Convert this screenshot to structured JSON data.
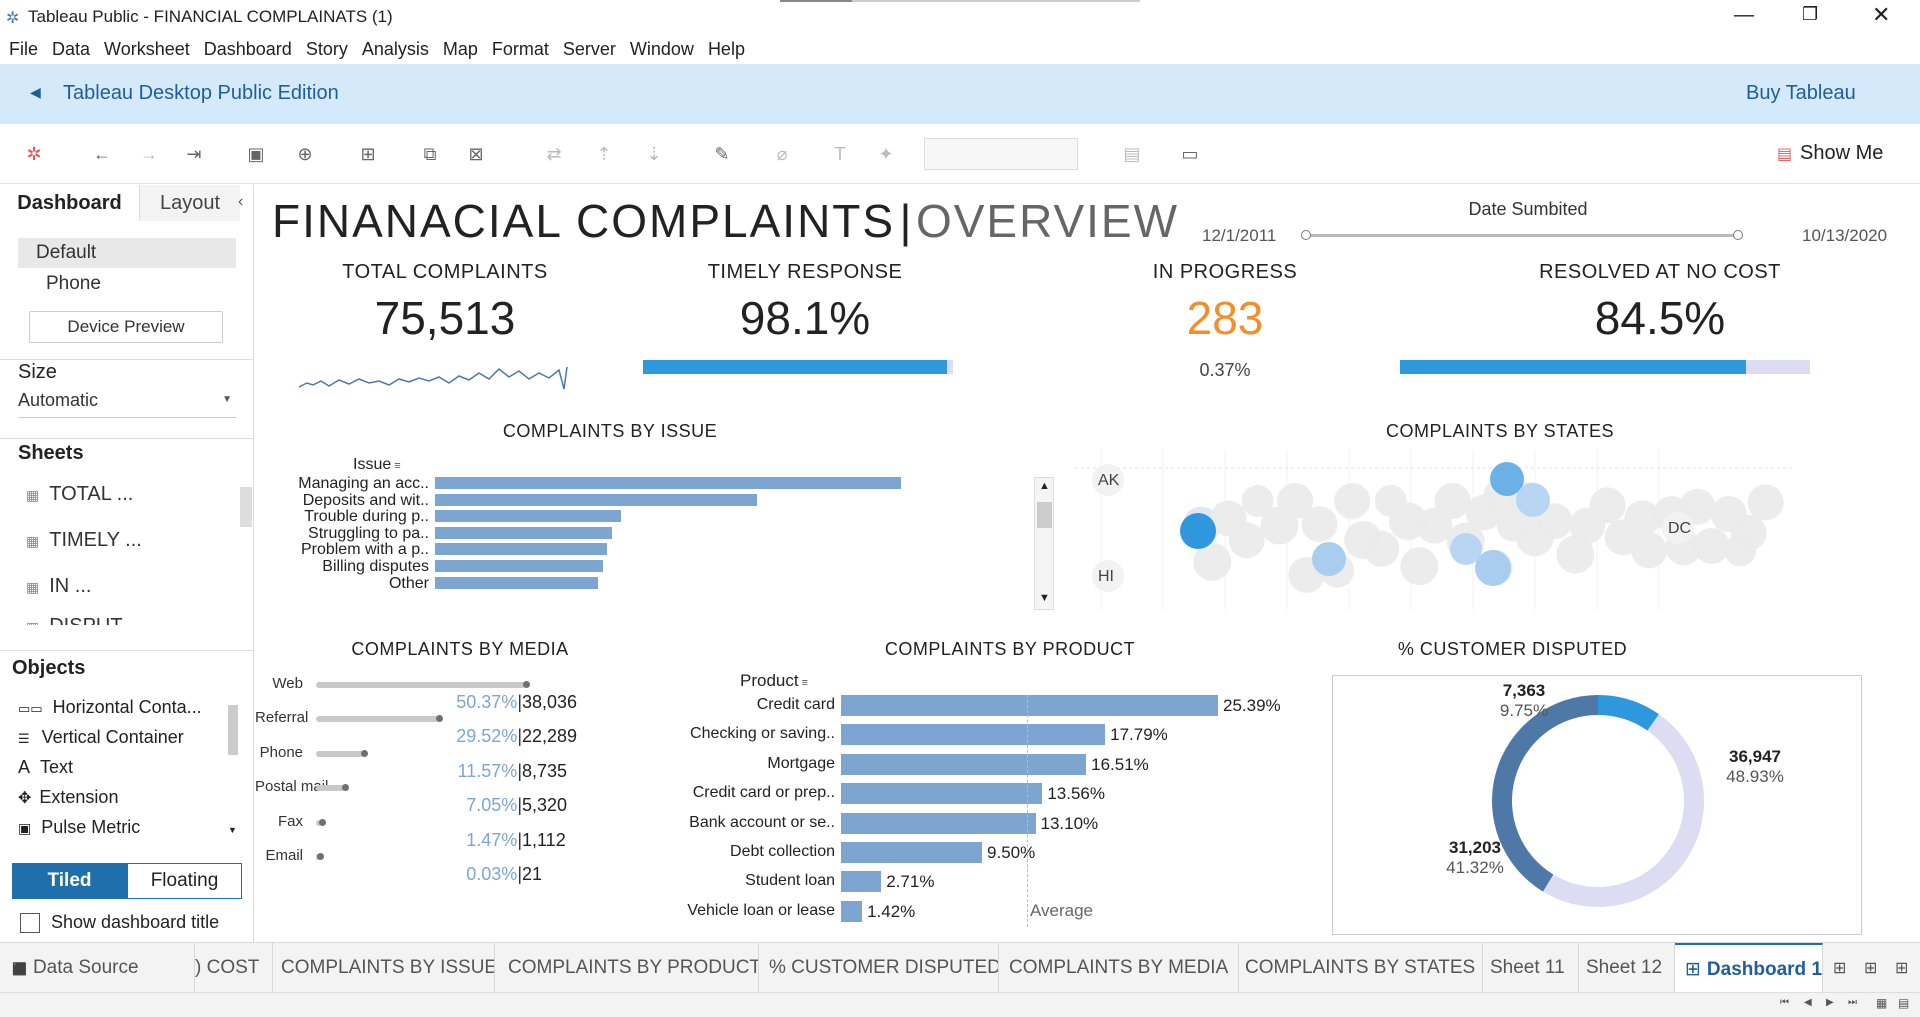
{
  "window": {
    "title": "Tableau Public - FINANCIAL COMPLAINATS (1)"
  },
  "menu": [
    "File",
    "Data",
    "Worksheet",
    "Dashboard",
    "Story",
    "Analysis",
    "Map",
    "Format",
    "Server",
    "Window",
    "Help"
  ],
  "banner": {
    "edition": "Tableau Desktop Public Edition",
    "buy": "Buy Tableau"
  },
  "toolbar": {
    "show_me": "Show Me"
  },
  "left": {
    "tabs": {
      "dashboard": "Dashboard",
      "layout": "Layout"
    },
    "devices": [
      "Default",
      "Phone"
    ],
    "device_preview": "Device Preview",
    "size_title": "Size",
    "size_value": "Automatic",
    "sheets_title": "Sheets",
    "sheets": [
      "TOTAL ...",
      "TIMELY ...",
      "IN ...",
      "DISPUT..."
    ],
    "objects_title": "Objects",
    "objects": [
      "Horizontal Conta...",
      "Vertical Container",
      "Text",
      "Extension",
      "Pulse Metric"
    ],
    "tiled": "Tiled",
    "floating": "Floating",
    "show_title": "Show dashboard title"
  },
  "dashboard": {
    "title_main": "FINANACIAL COMPLAINTS",
    "title_sep": "|",
    "title_sub": "OVERVIEW",
    "date_filter": {
      "label": "Date Sumbited",
      "start": "12/1/2011",
      "end": "10/13/2020"
    },
    "kpis": {
      "total": {
        "title": "TOTAL COMPLAINTS",
        "value": "75,513"
      },
      "timely": {
        "title": "TIMELY RESPONSE",
        "value": "98.1%",
        "fraction": 0.981
      },
      "progress": {
        "title": "IN PROGRESS",
        "value": "283",
        "pct": "0.37%"
      },
      "resolved": {
        "title": "RESOLVED AT NO COST",
        "value": "84.5%",
        "fraction": 0.845
      }
    },
    "colors": {
      "blue": "#2f97dc",
      "bar": "#7ea5cf",
      "lavender": "#dcdcf3",
      "orange": "#f28e2b",
      "dark_blue": "#4e79a7"
    }
  },
  "chart_data": [
    {
      "type": "bar",
      "title": "COMPLAINTS BY ISSUE",
      "xlabel": "",
      "ylabel": "Issue",
      "categories": [
        "Managing an acc..",
        "Deposits and wit..",
        "Trouble during p..",
        "Struggling to pa..",
        "Problem with a p..",
        "Billing disputes",
        "Other"
      ],
      "values": [
        100,
        69,
        40,
        38,
        37,
        36,
        35
      ]
    },
    {
      "type": "scatter",
      "title": "COMPLAINTS BY STATES",
      "labels": [
        "AK",
        "HI",
        "DC"
      ]
    },
    {
      "type": "bar",
      "title": "COMPLAINTS BY MEDIA",
      "categories": [
        "Web",
        "Referral",
        "Phone",
        "Postal mail",
        "Fax",
        "Email"
      ],
      "values": [
        38036,
        22289,
        8735,
        5320,
        1112,
        21
      ],
      "percents": [
        "50.37%",
        "29.52%",
        "11.57%",
        "7.05%",
        "1.47%",
        "0.03%"
      ],
      "value_labels": [
        "38,036",
        "22,289",
        "8,735",
        "5,320",
        "1,112",
        "21"
      ]
    },
    {
      "type": "bar",
      "title": "COMPLAINTS BY PRODUCT",
      "ylabel": "Product",
      "categories": [
        "Credit card",
        "Checking or saving..",
        "Mortgage",
        "Credit card or prep..",
        "Bank account or se..",
        "Debt collection",
        "Student loan",
        "Vehicle loan or lease"
      ],
      "values": [
        25.39,
        17.79,
        16.51,
        13.56,
        13.1,
        9.5,
        2.71,
        1.42
      ],
      "value_labels": [
        "25.39%",
        "17.79%",
        "16.51%",
        "13.56%",
        "13.10%",
        "9.50%",
        "2.71%",
        "1.42%"
      ],
      "reference_line": "Average"
    },
    {
      "type": "pie",
      "title": "% CUSTOMER DISPUTED",
      "slices": [
        {
          "count": "7,363",
          "pct": "9.75%",
          "value": 9.75,
          "color": "#2f97dc"
        },
        {
          "count": "36,947",
          "pct": "48.93%",
          "value": 48.93,
          "color": "#dcdcf3"
        },
        {
          "count": "31,203",
          "pct": "41.32%",
          "value": 41.32,
          "color": "#4e79a7"
        }
      ]
    }
  ],
  "sheet_tabs": [
    "Data Source",
    ") COST",
    "COMPLAINTS BY ISSUE",
    "COMPLAINTS BY PRODUCT",
    "% CUSTOMER DISPUTED",
    "COMPLAINTS BY MEDIA",
    "COMPLAINTS BY STATES",
    "Sheet 11",
    "Sheet 12",
    "Dashboard 1"
  ]
}
